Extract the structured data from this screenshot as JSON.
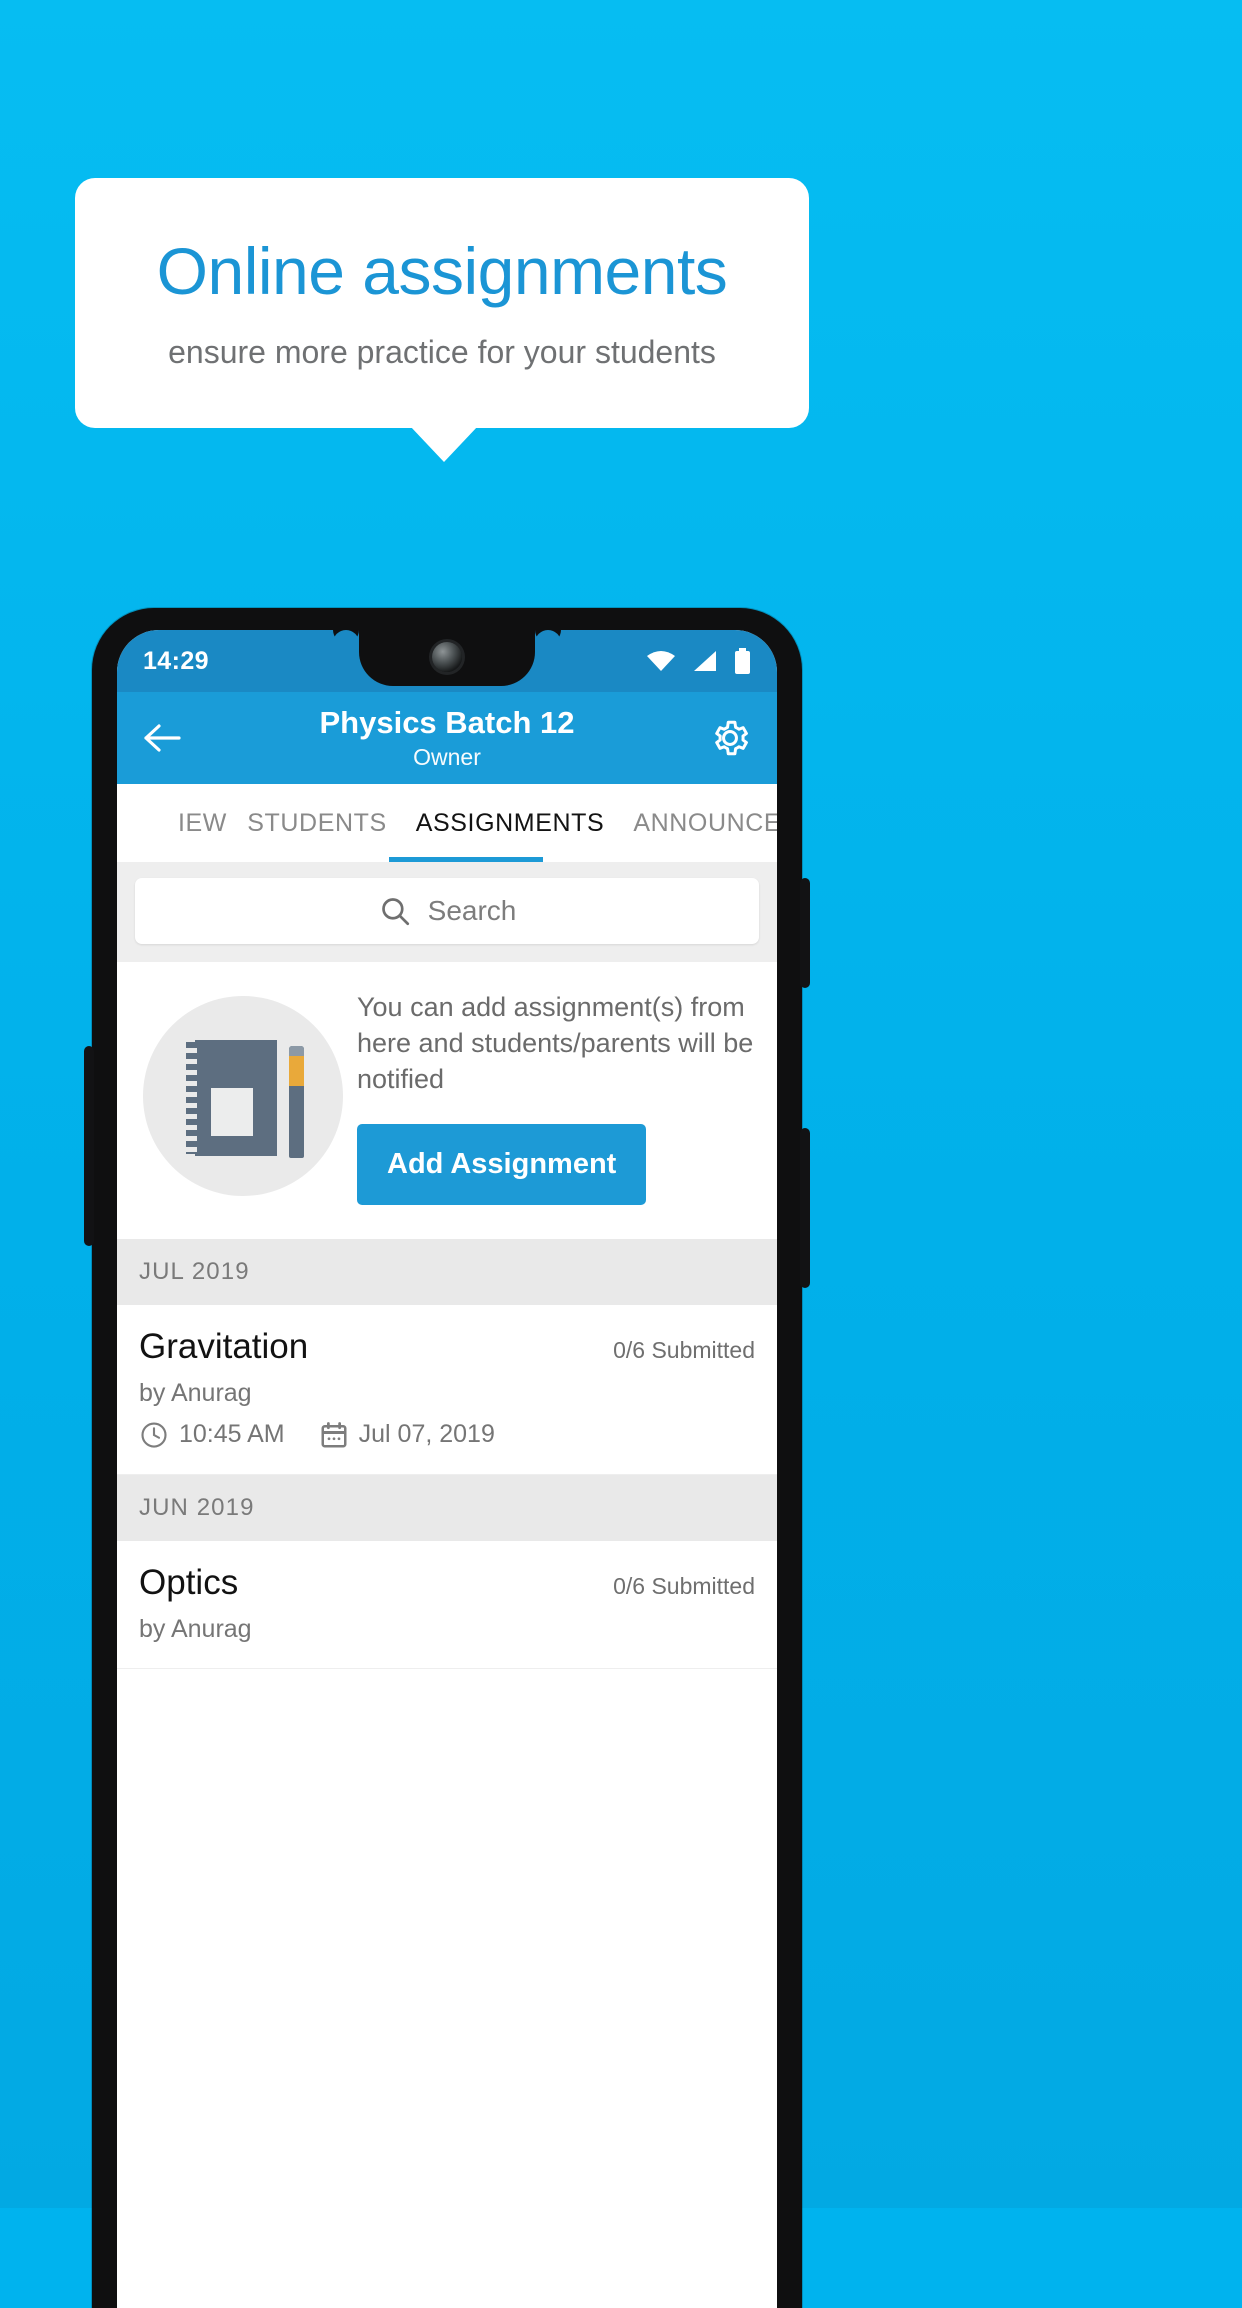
{
  "promo": {
    "title": "Online assignments",
    "subtitle": "ensure more practice for your students",
    "title_color": "#1b95d5",
    "background_color": "#00b3ee"
  },
  "phone": {
    "status_bar": {
      "time": "14:29",
      "icons": [
        "wifi-icon",
        "signal-icon",
        "battery-icon"
      ],
      "background_color": "#1a89c4"
    },
    "app_bar": {
      "back_icon": "back-arrow-icon",
      "title": "Physics Batch 12",
      "subtitle": "Owner",
      "settings_icon": "gear-icon",
      "background_color": "#1a9cd8"
    },
    "tabs": {
      "items": [
        {
          "label": "IEW",
          "active": false
        },
        {
          "label": "STUDENTS",
          "active": false
        },
        {
          "label": "ASSIGNMENTS",
          "active": true
        },
        {
          "label": "ANNOUNCEM",
          "active": false
        }
      ],
      "indicator_color": "#1d9ad6"
    },
    "search": {
      "icon": "search-icon",
      "placeholder": "Search",
      "value": ""
    },
    "empty_state": {
      "illustration": "notebook-pen-icon",
      "message": "You can add assignment(s) from here and students/parents will be notified",
      "button_label": "Add Assignment",
      "button_color": "#1d9ad6"
    },
    "groups": [
      {
        "month": "JUL 2019",
        "assignments": [
          {
            "title": "Gravitation",
            "submitted": "0/6 Submitted",
            "author": "by Anurag",
            "time_icon": "clock-icon",
            "time": "10:45 AM",
            "date_icon": "calendar-icon",
            "date": "Jul 07, 2019"
          }
        ]
      },
      {
        "month": "JUN 2019",
        "assignments": [
          {
            "title": "Optics",
            "submitted": "0/6 Submitted",
            "author": "by Anurag",
            "time_icon": "clock-icon",
            "time": "",
            "date_icon": "calendar-icon",
            "date": ""
          }
        ]
      }
    ]
  }
}
